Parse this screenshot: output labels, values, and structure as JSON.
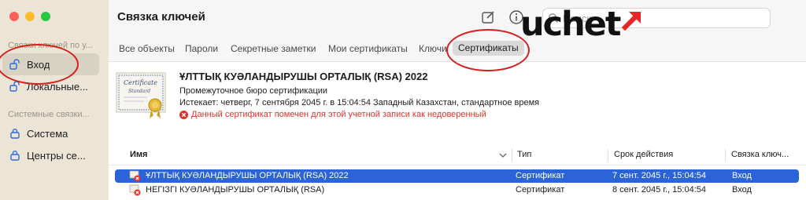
{
  "sidebar": {
    "section1": "Связки ключей по у...",
    "items1": [
      {
        "label": "Вход",
        "icon": "lock-open-icon",
        "selected": true
      },
      {
        "label": "Локальные...",
        "icon": "lock-open-icon",
        "selected": false
      }
    ],
    "section2": "Системные связки...",
    "items2": [
      {
        "label": "Система",
        "icon": "lock-icon",
        "selected": false
      },
      {
        "label": "Центры се...",
        "icon": "lock-icon",
        "selected": false
      }
    ]
  },
  "toolbar": {
    "title": "Связка ключей",
    "search_placeholder": "Поиск",
    "compose_icon": "compose-icon",
    "info_icon": "info-icon"
  },
  "logo": {
    "text": "uchet",
    "arrow_color": "#e8262a"
  },
  "tabs": [
    "Все объекты",
    "Пароли",
    "Секретные заметки",
    "Мои сертификаты",
    "Ключи",
    "Сертификаты"
  ],
  "selected_tab": "Сертификаты",
  "cert": {
    "image_text_1": "Certificate",
    "image_text_2": "Standard",
    "name": "ҰЛТТЫҚ КУӘЛАНДЫРУШЫ ОРТАЛЫҚ (RSA) 2022",
    "type_line": "Промежуточное бюро сертификации",
    "expires_line": "Истекает: четверг, 7 сентября 2045 г. в 15:04:54 Западный Казахстан, стандартное время",
    "warning": "Данный сертификат помечен для этой учетной записи как недоверенный"
  },
  "table": {
    "columns": [
      "Имя",
      "Тип",
      "Срок действия",
      "Связка ключ..."
    ],
    "rows": [
      {
        "name": "ҰЛТТЫҚ КУӘЛАНДЫРУШЫ ОРТАЛЫҚ (RSA) 2022",
        "type": "Сертификат",
        "expires": "7 сент. 2045 г., 15:04:54",
        "keychain": "Вход",
        "selected": true
      },
      {
        "name": "НЕГІЗГІ КУӘЛАНДЫРУШЫ ОРТАЛЫҚ (RSA)",
        "type": "Сертификат",
        "expires": "8 сент. 2045 г., 15:04:54",
        "keychain": "Вход",
        "selected": false
      }
    ]
  },
  "colors": {
    "accent": "#2a64d8",
    "warning": "#e0342a",
    "annotation": "#d61f1f",
    "sidebar_bg": "#ece5d5"
  }
}
